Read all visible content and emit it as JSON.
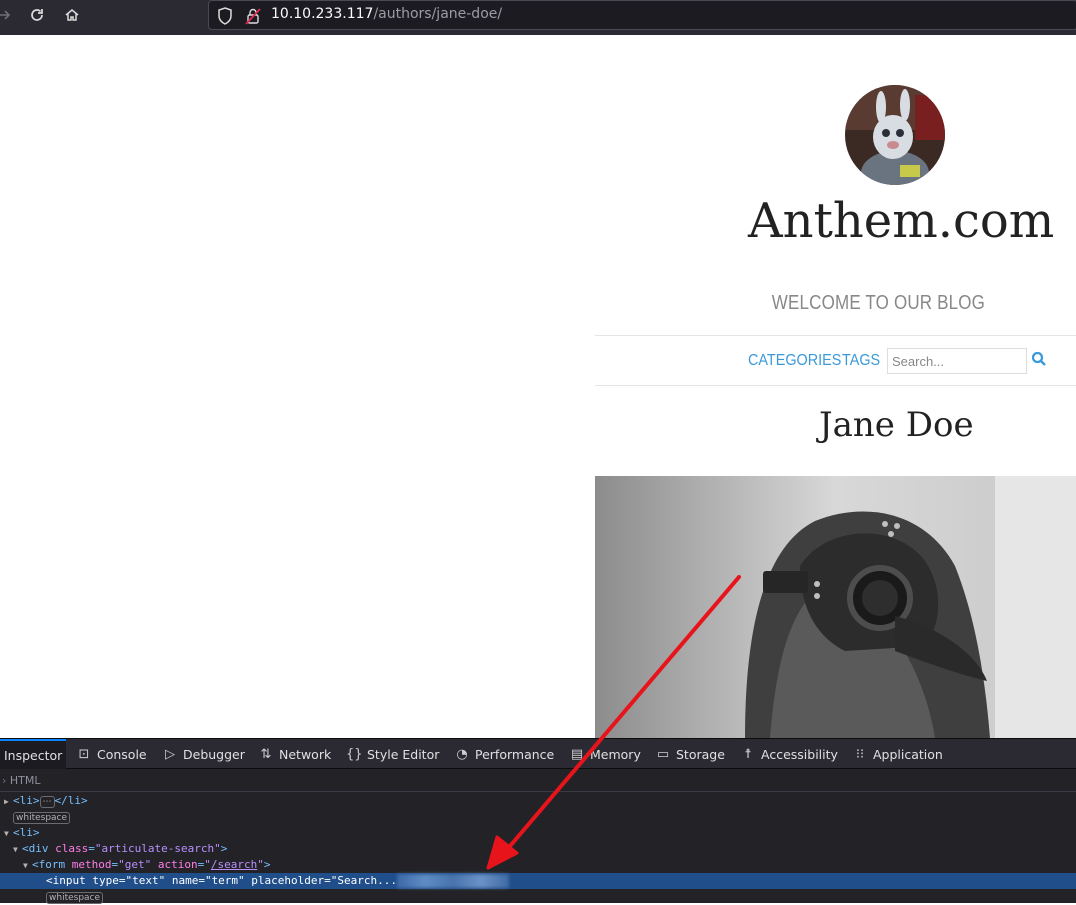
{
  "browser": {
    "url_host": "10.10.233.117",
    "url_path": "/authors/jane-doe/"
  },
  "site": {
    "title": "Anthem.com",
    "tagline": "WELCOME TO OUR BLOG",
    "nav": {
      "categories": "CATEGORIES",
      "tags": "TAGS",
      "search_placeholder": "Search..."
    },
    "author_name": "Jane Doe"
  },
  "devtools": {
    "tabs": [
      {
        "label": "Inspector",
        "icon": "inspector-icon"
      },
      {
        "label": "Console",
        "icon": "console-icon"
      },
      {
        "label": "Debugger",
        "icon": "debugger-icon"
      },
      {
        "label": "Network",
        "icon": "network-icon"
      },
      {
        "label": "Style Editor",
        "icon": "style-editor-icon"
      },
      {
        "label": "Performance",
        "icon": "performance-icon"
      },
      {
        "label": "Memory",
        "icon": "memory-icon"
      },
      {
        "label": "Storage",
        "icon": "storage-icon"
      },
      {
        "label": "Accessibility",
        "icon": "accessibility-icon"
      },
      {
        "label": "Application",
        "icon": "application-icon"
      }
    ],
    "breadcrumb": "HTML",
    "markup": {
      "li_collapsed_open": "<li>",
      "ellipsis": "⋯",
      "li_collapsed_close": "</li>",
      "whitespace": "whitespace",
      "li_open": "<li>",
      "div_tag": "div",
      "div_attr": "class",
      "div_val": "\"articulate-search\"",
      "form_tag": "form",
      "form_attr1": "method",
      "form_val1": "\"get\"",
      "form_attr2": "action",
      "form_val2": "/search",
      "input_line": "<input type=\"text\" name=\"term\" placeholder=\"Search..."
    }
  },
  "colors": {
    "accent": "#3a9ad9",
    "devtools_bg": "#232327",
    "selection": "#204e8a",
    "arrow": "#e8141b"
  }
}
